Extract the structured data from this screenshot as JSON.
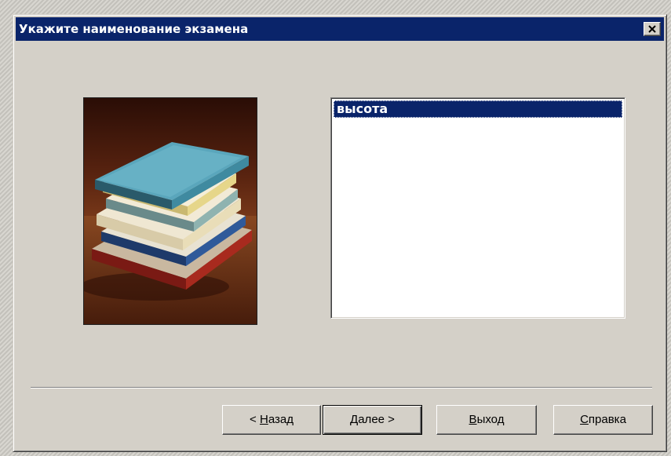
{
  "window": {
    "title": "Укажите наименование экзамена",
    "close_icon": "close-icon"
  },
  "picture": {
    "icon": "books-stack-image"
  },
  "exam_list": {
    "items": [
      {
        "label": "высота",
        "selected": true
      }
    ]
  },
  "buttons": {
    "back": {
      "prefix": "< ",
      "mnemonic": "Н",
      "rest": "азад"
    },
    "next": {
      "mnemonic": "Д",
      "rest": "алее",
      "suffix": " >"
    },
    "exit": {
      "mnemonic": "В",
      "rest": "ыход"
    },
    "help": {
      "mnemonic": "С",
      "rest": "правка"
    }
  },
  "colors": {
    "titlebar": "#0a246a",
    "dialog": "#d4d0c8",
    "selection": "#0a246a"
  }
}
